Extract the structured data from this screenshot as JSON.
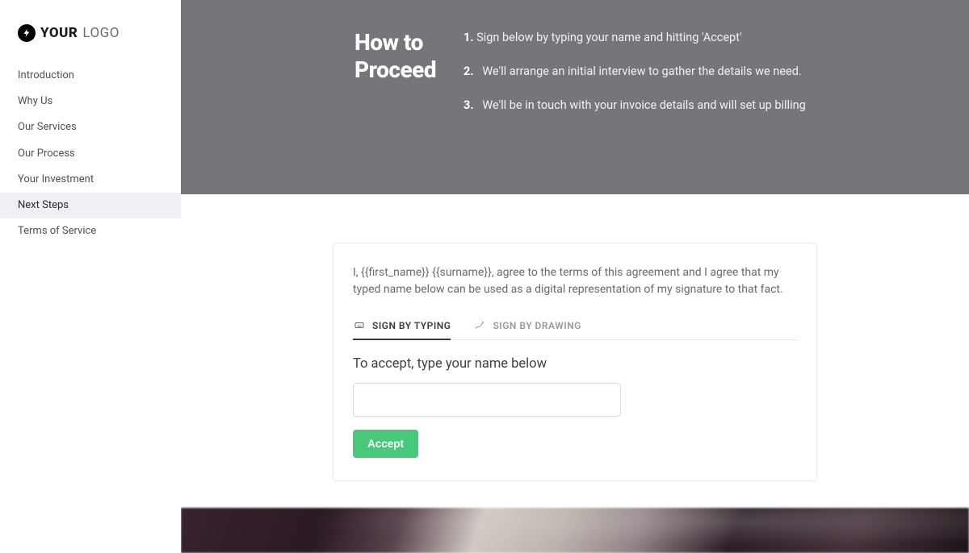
{
  "logo": {
    "mark_glyph": "⚡",
    "text_bold": "YOUR",
    "text_light": "LOGO"
  },
  "nav": {
    "items": [
      {
        "label": "Introduction",
        "active": false
      },
      {
        "label": "Why Us",
        "active": false
      },
      {
        "label": "Our Services",
        "active": false
      },
      {
        "label": "Our Process",
        "active": false
      },
      {
        "label": "Your Investment",
        "active": false
      },
      {
        "label": "Next Steps",
        "active": true
      },
      {
        "label": "Terms of Service",
        "active": false
      }
    ]
  },
  "header": {
    "title": "How to Proceed",
    "steps": [
      {
        "num": "1.",
        "text": "Sign below by typing your name and hitting 'Accept'"
      },
      {
        "num": "2.",
        "text": "We'll arrange an initial interview to gather the details we need."
      },
      {
        "num": "3.",
        "text": "We'll be in touch with your invoice details and will set up billing"
      }
    ]
  },
  "sign": {
    "agreement": "I, {{first_name}} {{surname}}, agree to the terms of this agreement and I agree that my typed name below can be used as a digital representation of my signature to that fact.",
    "tabs": {
      "typing": "SIGN BY TYPING",
      "drawing": "SIGN BY DRAWING"
    },
    "accept_label": "To accept, type your name below",
    "input_value": "",
    "input_placeholder": "",
    "accept_button": "Accept"
  }
}
